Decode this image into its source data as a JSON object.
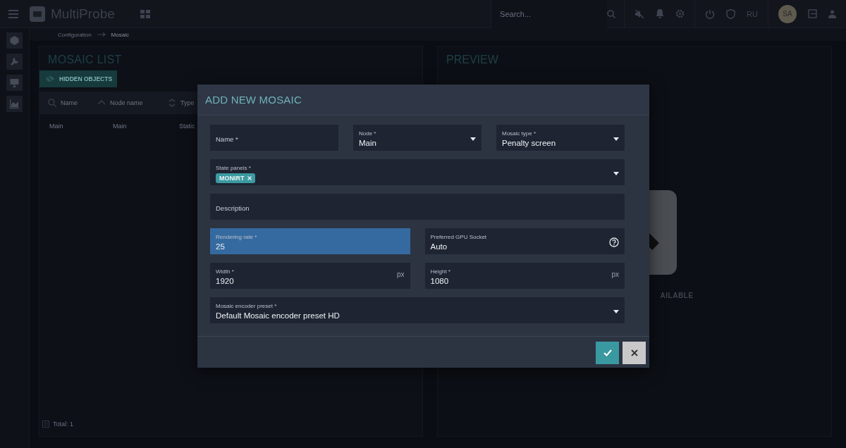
{
  "topbar": {
    "app_name": "MultiProbe",
    "search": {
      "placeholder": "Search..."
    },
    "language": "RU",
    "avatar": "SA"
  },
  "breadcrumb": [
    "Configuration",
    "Mosaic"
  ],
  "mosaic_list": {
    "title": "MOSAIC LIST",
    "hidden_objects_button": "HIDDEN OBJECTS",
    "columns": [
      {
        "label": "Name",
        "kind": "search"
      },
      {
        "label": "Node name",
        "kind": "sort_asc"
      },
      {
        "label": "Type",
        "kind": "sortable"
      }
    ],
    "rows": [
      [
        "Main",
        "Main",
        "Static"
      ]
    ],
    "total": "Total: 1"
  },
  "preview": {
    "title": "PREVIEW",
    "message": "AILABLE"
  },
  "dialog": {
    "title": "ADD NEW MOSAIC",
    "rows": [
      [
        {
          "kind": "text",
          "label": "Name *",
          "focused": false
        },
        {
          "kind": "select",
          "label": "Node *",
          "value": "Main",
          "focused": false
        },
        {
          "kind": "select",
          "label": "Mosaic type *",
          "value": "Penalty screen",
          "focused": false
        }
      ],
      [
        {
          "kind": "chips",
          "label": "State panels *",
          "chips": [
            "MONIRT"
          ],
          "focused": false
        }
      ],
      [
        {
          "kind": "text",
          "label": "Description",
          "focused": false
        }
      ],
      [
        {
          "kind": "text",
          "label": "Rendering rate *",
          "value": "25",
          "focused": true
        },
        {
          "kind": "help",
          "label": "Preferred GPU Socket",
          "value": "Auto",
          "focused": false
        }
      ],
      [
        {
          "kind": "unit",
          "label": "Width *",
          "value": "1920",
          "unit": "px",
          "focused": false
        },
        {
          "kind": "unit",
          "label": "Height *",
          "value": "1080",
          "unit": "px",
          "focused": false
        }
      ],
      [
        {
          "kind": "select",
          "label": "Mosaic encoder preset *",
          "value": "Default Mosaic encoder preset HD",
          "focused": false
        }
      ]
    ],
    "buttons": [
      {
        "kind": "confirm"
      },
      {
        "kind": "cancel"
      }
    ]
  }
}
